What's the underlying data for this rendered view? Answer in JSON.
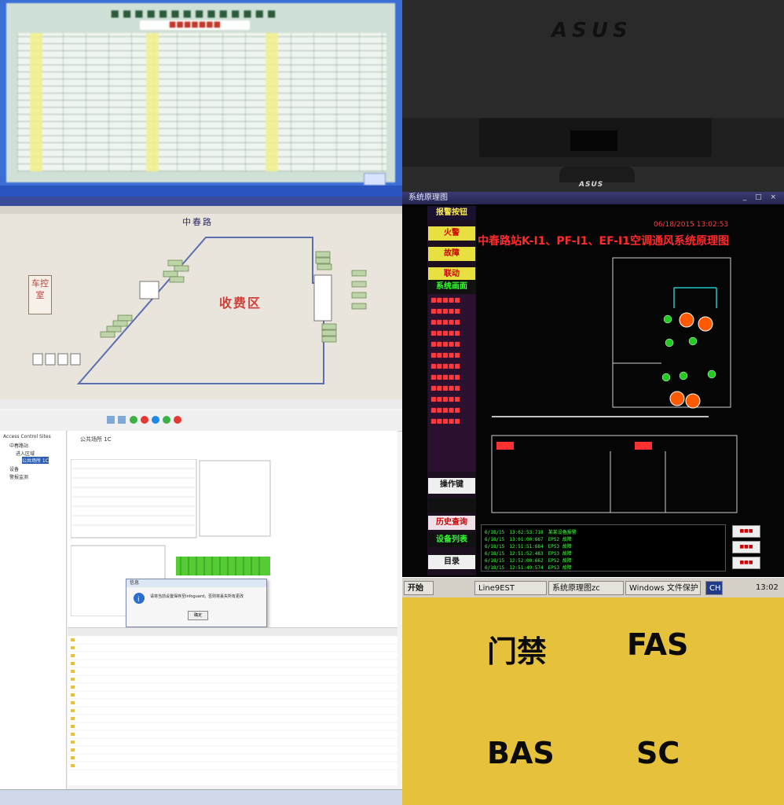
{
  "labels": {
    "top_left": "门禁",
    "top_right": "FAS",
    "bottom_left": "BAS",
    "bottom_right": "SC"
  },
  "monitor": {
    "brand": "ASUS",
    "brand_small": "ASUS"
  },
  "bas": {
    "title": "中春路",
    "room_label": "车控室",
    "zone_label": "收费区"
  },
  "fas": {
    "window_title": "系统原理图",
    "datetime": "06/18/2015 13:02:53",
    "main_title": "中春路站K-I1、PF-I1、EF-I1空调通风系统原理图",
    "side_top": "报警按钮",
    "side_buttons": [
      "火警",
      "故障",
      "联动",
      "系统画面"
    ],
    "side_mid": [
      "操作键",
      "历史查询",
      "设备列表",
      "目录"
    ],
    "taskbar": {
      "start": "开始",
      "item1": "Line9EST",
      "item2": "系统原理图zc",
      "item3": "Windows 文件保护",
      "lang": "CH",
      "clock": "13:02"
    },
    "events": [
      [
        "6/18/15",
        "13:02:53:718",
        "某某设备报警"
      ],
      [
        "6/18/15",
        "13:01:00:667",
        "EPS2 故障"
      ],
      [
        "6/18/15",
        "12:51:51:684",
        "EPS3 故障"
      ],
      [
        "6/18/15",
        "12:51:52:483",
        "EPS3 故障"
      ],
      [
        "6/18/15",
        "12:52:00:662",
        "EPS2 故障"
      ],
      [
        "6/18/15",
        "12:51:49:574",
        "EPS3 故障"
      ]
    ]
  },
  "access": {
    "tree_root": "Access Control Sites",
    "tree_items": [
      "中春路站",
      "进入区域",
      "公共场所 1C",
      "设备",
      "警报监测"
    ],
    "header": "公共场所 1C",
    "confirm_title": "信息",
    "confirm_msg": "请将当前设置保存至Infoguard，否则将丢失所有更改",
    "confirm_ok": "确定"
  }
}
